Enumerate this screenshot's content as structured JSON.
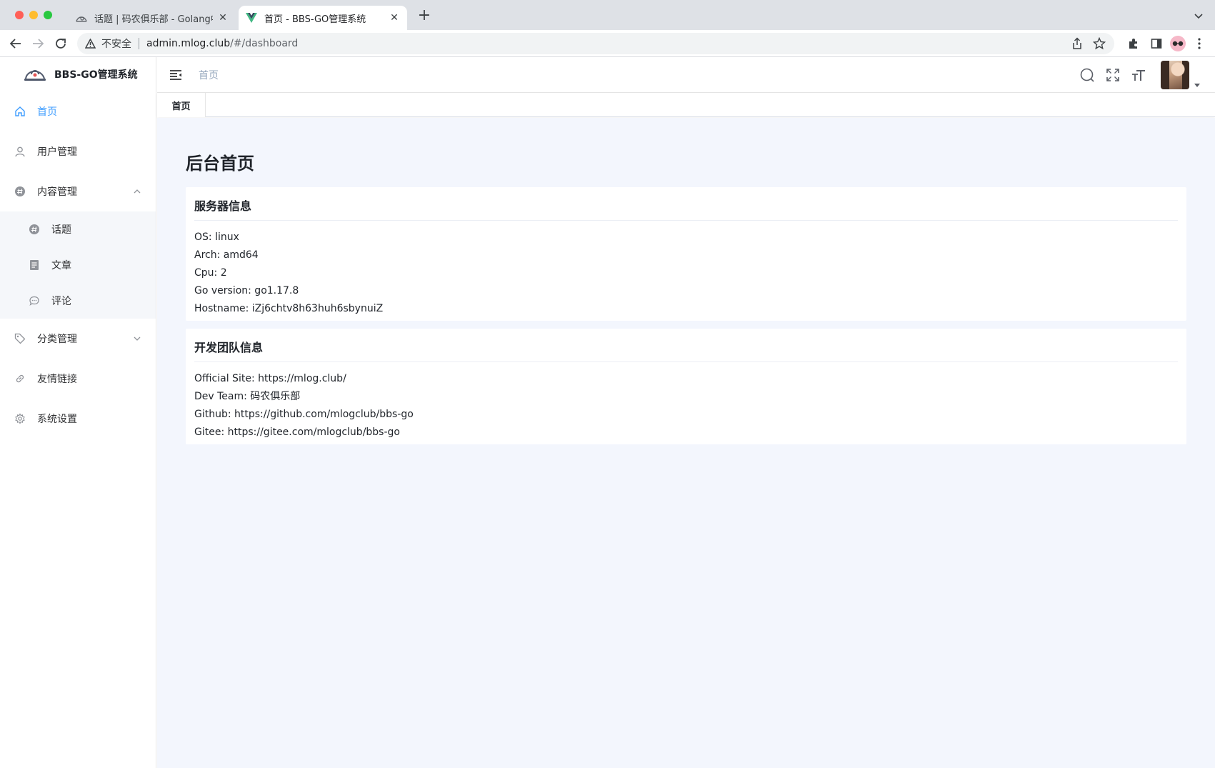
{
  "browser": {
    "tabs": [
      {
        "title": "话题 | 码农俱乐部 - Golang中国",
        "close": "✕"
      },
      {
        "title": "首页 - BBS-GO管理系统",
        "close": "✕"
      }
    ],
    "new_tab": "+",
    "address": {
      "security_label": "不安全",
      "host": "admin.mlog.club",
      "path": "/#/dashboard"
    }
  },
  "sidebar": {
    "brand": "BBS-GO管理系统",
    "items": [
      {
        "label": "首页",
        "icon": "home-icon"
      },
      {
        "label": "用户管理",
        "icon": "user-icon"
      },
      {
        "label": "内容管理",
        "icon": "content-icon"
      },
      {
        "label": "分类管理",
        "icon": "tag-icon"
      },
      {
        "label": "友情链接",
        "icon": "link-icon"
      },
      {
        "label": "系统设置",
        "icon": "gear-icon"
      }
    ],
    "content_sub": [
      {
        "label": "话题",
        "icon": "topic-icon"
      },
      {
        "label": "文章",
        "icon": "article-icon"
      },
      {
        "label": "评论",
        "icon": "comment-icon"
      }
    ]
  },
  "header": {
    "breadcrumb": "首页"
  },
  "tags": {
    "active": "首页"
  },
  "main": {
    "title": "后台首页",
    "server": {
      "title": "服务器信息",
      "lines": [
        "OS: linux",
        "Arch: amd64",
        "Cpu: 2",
        "Go version: go1.17.8",
        "Hostname: iZj6chtv8h63huh6sbynuiZ"
      ]
    },
    "team": {
      "title": "开发团队信息",
      "lines": [
        "Official Site: https://mlog.club/",
        "Dev Team: 码农俱乐部",
        "Github: https://github.com/mlogclub/bbs-go",
        "Gitee: https://gitee.com/mlogclub/bbs-go"
      ]
    }
  },
  "colors": {
    "accent": "#409eff",
    "main_bg": "#f3f6fd",
    "breadcrumb": "#97a8be"
  }
}
